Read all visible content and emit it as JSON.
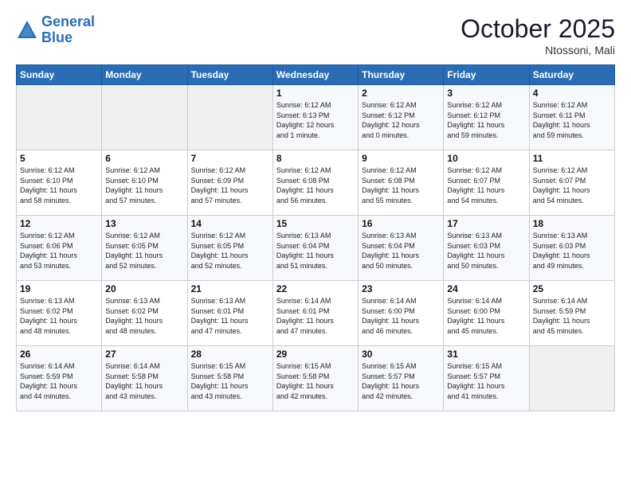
{
  "header": {
    "logo_line1": "General",
    "logo_line2": "Blue",
    "month": "October 2025",
    "location": "Ntossoni, Mali"
  },
  "weekdays": [
    "Sunday",
    "Monday",
    "Tuesday",
    "Wednesday",
    "Thursday",
    "Friday",
    "Saturday"
  ],
  "weeks": [
    [
      {
        "day": "",
        "info": ""
      },
      {
        "day": "",
        "info": ""
      },
      {
        "day": "",
        "info": ""
      },
      {
        "day": "1",
        "info": "Sunrise: 6:12 AM\nSunset: 6:13 PM\nDaylight: 12 hours\nand 1 minute."
      },
      {
        "day": "2",
        "info": "Sunrise: 6:12 AM\nSunset: 6:12 PM\nDaylight: 12 hours\nand 0 minutes."
      },
      {
        "day": "3",
        "info": "Sunrise: 6:12 AM\nSunset: 6:12 PM\nDaylight: 11 hours\nand 59 minutes."
      },
      {
        "day": "4",
        "info": "Sunrise: 6:12 AM\nSunset: 6:11 PM\nDaylight: 11 hours\nand 59 minutes."
      }
    ],
    [
      {
        "day": "5",
        "info": "Sunrise: 6:12 AM\nSunset: 6:10 PM\nDaylight: 11 hours\nand 58 minutes."
      },
      {
        "day": "6",
        "info": "Sunrise: 6:12 AM\nSunset: 6:10 PM\nDaylight: 11 hours\nand 57 minutes."
      },
      {
        "day": "7",
        "info": "Sunrise: 6:12 AM\nSunset: 6:09 PM\nDaylight: 11 hours\nand 57 minutes."
      },
      {
        "day": "8",
        "info": "Sunrise: 6:12 AM\nSunset: 6:08 PM\nDaylight: 11 hours\nand 56 minutes."
      },
      {
        "day": "9",
        "info": "Sunrise: 6:12 AM\nSunset: 6:08 PM\nDaylight: 11 hours\nand 55 minutes."
      },
      {
        "day": "10",
        "info": "Sunrise: 6:12 AM\nSunset: 6:07 PM\nDaylight: 11 hours\nand 54 minutes."
      },
      {
        "day": "11",
        "info": "Sunrise: 6:12 AM\nSunset: 6:07 PM\nDaylight: 11 hours\nand 54 minutes."
      }
    ],
    [
      {
        "day": "12",
        "info": "Sunrise: 6:12 AM\nSunset: 6:06 PM\nDaylight: 11 hours\nand 53 minutes."
      },
      {
        "day": "13",
        "info": "Sunrise: 6:12 AM\nSunset: 6:05 PM\nDaylight: 11 hours\nand 52 minutes."
      },
      {
        "day": "14",
        "info": "Sunrise: 6:12 AM\nSunset: 6:05 PM\nDaylight: 11 hours\nand 52 minutes."
      },
      {
        "day": "15",
        "info": "Sunrise: 6:13 AM\nSunset: 6:04 PM\nDaylight: 11 hours\nand 51 minutes."
      },
      {
        "day": "16",
        "info": "Sunrise: 6:13 AM\nSunset: 6:04 PM\nDaylight: 11 hours\nand 50 minutes."
      },
      {
        "day": "17",
        "info": "Sunrise: 6:13 AM\nSunset: 6:03 PM\nDaylight: 11 hours\nand 50 minutes."
      },
      {
        "day": "18",
        "info": "Sunrise: 6:13 AM\nSunset: 6:03 PM\nDaylight: 11 hours\nand 49 minutes."
      }
    ],
    [
      {
        "day": "19",
        "info": "Sunrise: 6:13 AM\nSunset: 6:02 PM\nDaylight: 11 hours\nand 48 minutes."
      },
      {
        "day": "20",
        "info": "Sunrise: 6:13 AM\nSunset: 6:02 PM\nDaylight: 11 hours\nand 48 minutes."
      },
      {
        "day": "21",
        "info": "Sunrise: 6:13 AM\nSunset: 6:01 PM\nDaylight: 11 hours\nand 47 minutes."
      },
      {
        "day": "22",
        "info": "Sunrise: 6:14 AM\nSunset: 6:01 PM\nDaylight: 11 hours\nand 47 minutes."
      },
      {
        "day": "23",
        "info": "Sunrise: 6:14 AM\nSunset: 6:00 PM\nDaylight: 11 hours\nand 46 minutes."
      },
      {
        "day": "24",
        "info": "Sunrise: 6:14 AM\nSunset: 6:00 PM\nDaylight: 11 hours\nand 45 minutes."
      },
      {
        "day": "25",
        "info": "Sunrise: 6:14 AM\nSunset: 5:59 PM\nDaylight: 11 hours\nand 45 minutes."
      }
    ],
    [
      {
        "day": "26",
        "info": "Sunrise: 6:14 AM\nSunset: 5:59 PM\nDaylight: 11 hours\nand 44 minutes."
      },
      {
        "day": "27",
        "info": "Sunrise: 6:14 AM\nSunset: 5:58 PM\nDaylight: 11 hours\nand 43 minutes."
      },
      {
        "day": "28",
        "info": "Sunrise: 6:15 AM\nSunset: 5:58 PM\nDaylight: 11 hours\nand 43 minutes."
      },
      {
        "day": "29",
        "info": "Sunrise: 6:15 AM\nSunset: 5:58 PM\nDaylight: 11 hours\nand 42 minutes."
      },
      {
        "day": "30",
        "info": "Sunrise: 6:15 AM\nSunset: 5:57 PM\nDaylight: 11 hours\nand 42 minutes."
      },
      {
        "day": "31",
        "info": "Sunrise: 6:15 AM\nSunset: 5:57 PM\nDaylight: 11 hours\nand 41 minutes."
      },
      {
        "day": "",
        "info": ""
      }
    ]
  ]
}
